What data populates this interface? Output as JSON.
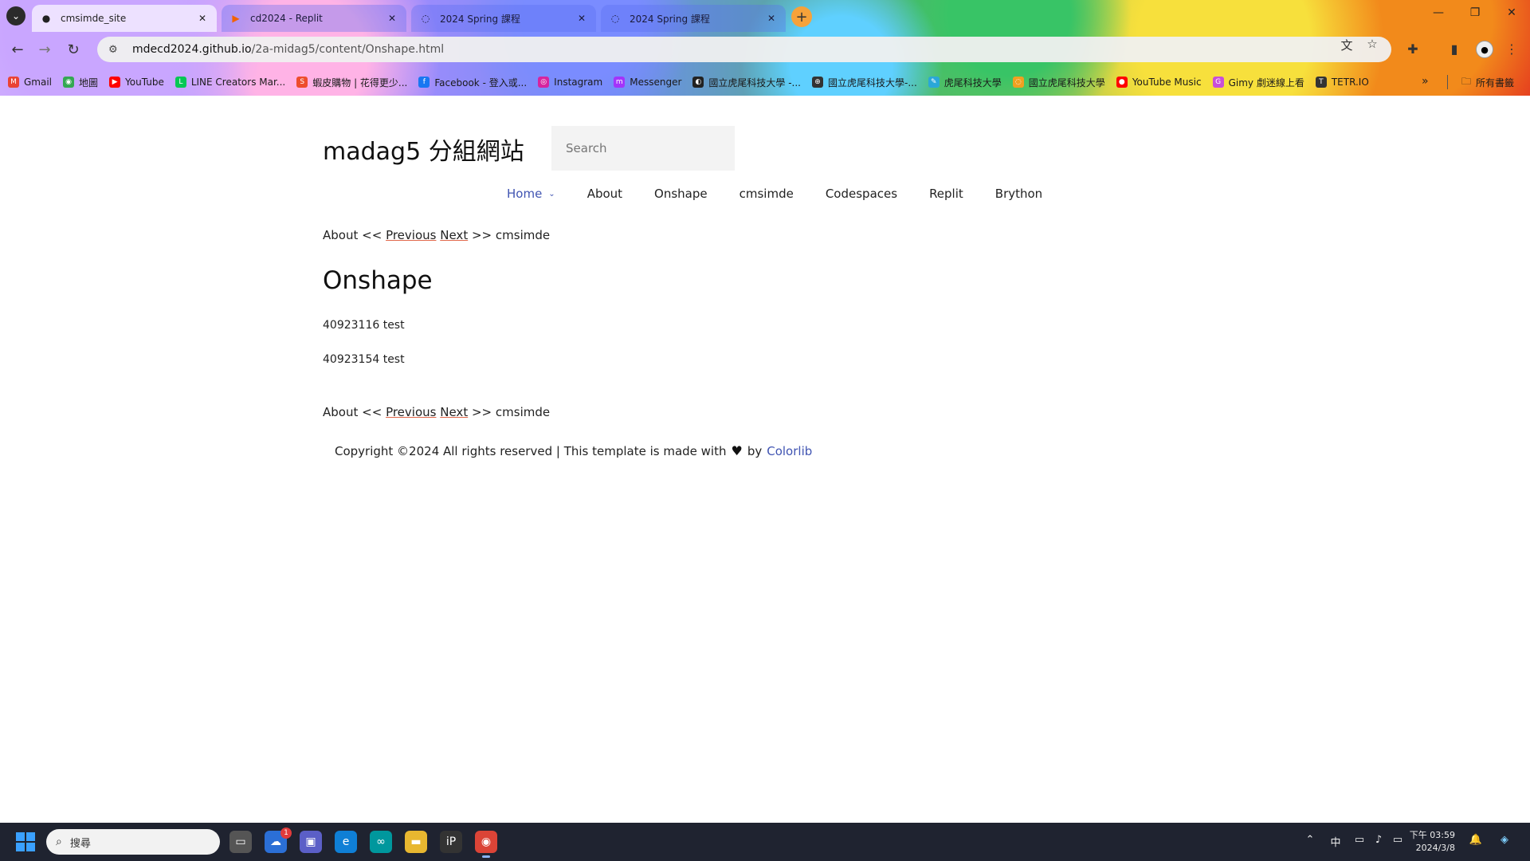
{
  "browser": {
    "tabs": [
      {
        "title": "cmsimde_site",
        "icon": "github-icon",
        "active": true
      },
      {
        "title": "cd2024 - Replit",
        "icon": "replit-icon",
        "active": false
      },
      {
        "title": "2024 Spring 課程",
        "icon": "globe-icon",
        "active": false
      },
      {
        "title": "2024 Spring 課程",
        "icon": "globe-icon",
        "active": false
      }
    ],
    "url_host": "mdecd2024.github.io",
    "url_path": "/2a-midag5/content/Onshape.html",
    "bookmarks": [
      {
        "label": "Gmail",
        "color": "#ea4335",
        "glyph": "M"
      },
      {
        "label": "地圖",
        "color": "#34a853",
        "glyph": "◉"
      },
      {
        "label": "YouTube",
        "color": "#ff0000",
        "glyph": "▶"
      },
      {
        "label": "LINE Creators Mar...",
        "color": "#06c755",
        "glyph": "L"
      },
      {
        "label": "蝦皮購物 | 花得更少...",
        "color": "#ee4d2d",
        "glyph": "S"
      },
      {
        "label": "Facebook - 登入或...",
        "color": "#1877f2",
        "glyph": "f"
      },
      {
        "label": "Instagram",
        "color": "#d6249f",
        "glyph": "◎"
      },
      {
        "label": "Messenger",
        "color": "#a334fa",
        "glyph": "m"
      },
      {
        "label": "國立虎尾科技大學 -...",
        "color": "#222222",
        "glyph": "◐"
      },
      {
        "label": "國立虎尾科技大學-...",
        "color": "#333333",
        "glyph": "⊕"
      },
      {
        "label": "虎尾科技大學",
        "color": "#2aa7d8",
        "glyph": "✎"
      },
      {
        "label": "國立虎尾科技大學",
        "color": "#f0a020",
        "glyph": "◌"
      },
      {
        "label": "YouTube Music",
        "color": "#ff0000",
        "glyph": "●"
      },
      {
        "label": "Gimy 劇迷線上看",
        "color": "#c84fd8",
        "glyph": "G"
      },
      {
        "label": "TETR.IO",
        "color": "#333333",
        "glyph": "T"
      }
    ],
    "all_bookmarks_label": "所有書籤",
    "more_label": "»"
  },
  "site": {
    "title": "madag5 分組網站",
    "search_placeholder": "Search",
    "nav": [
      {
        "label": "Home",
        "current": true
      },
      {
        "label": "About"
      },
      {
        "label": "Onshape"
      },
      {
        "label": "cmsimde"
      },
      {
        "label": "Codespaces"
      },
      {
        "label": "Replit"
      },
      {
        "label": "Brython"
      }
    ]
  },
  "content": {
    "pager": {
      "prev_page": "About",
      "prev_sep": "<<",
      "previous": "Previous",
      "next": "Next",
      "next_sep": ">>",
      "next_page": "cmsimde"
    },
    "heading": "Onshape",
    "paragraphs": [
      "40923116 test",
      "40923154 test"
    ],
    "footer": {
      "text": "Copyright ©2024 All rights reserved | This template is made with",
      "heart": "♥",
      "by": "by",
      "link": "Colorlib"
    }
  },
  "taskbar": {
    "search_placeholder": "搜尋",
    "badge_count": "1",
    "ime": "中",
    "time": "下午 03:59",
    "date": "2024/3/8"
  },
  "colors": {
    "nav_active": "#4054b2",
    "link_underline": "#e0674a",
    "taskbar_bg": "#1f2330"
  }
}
